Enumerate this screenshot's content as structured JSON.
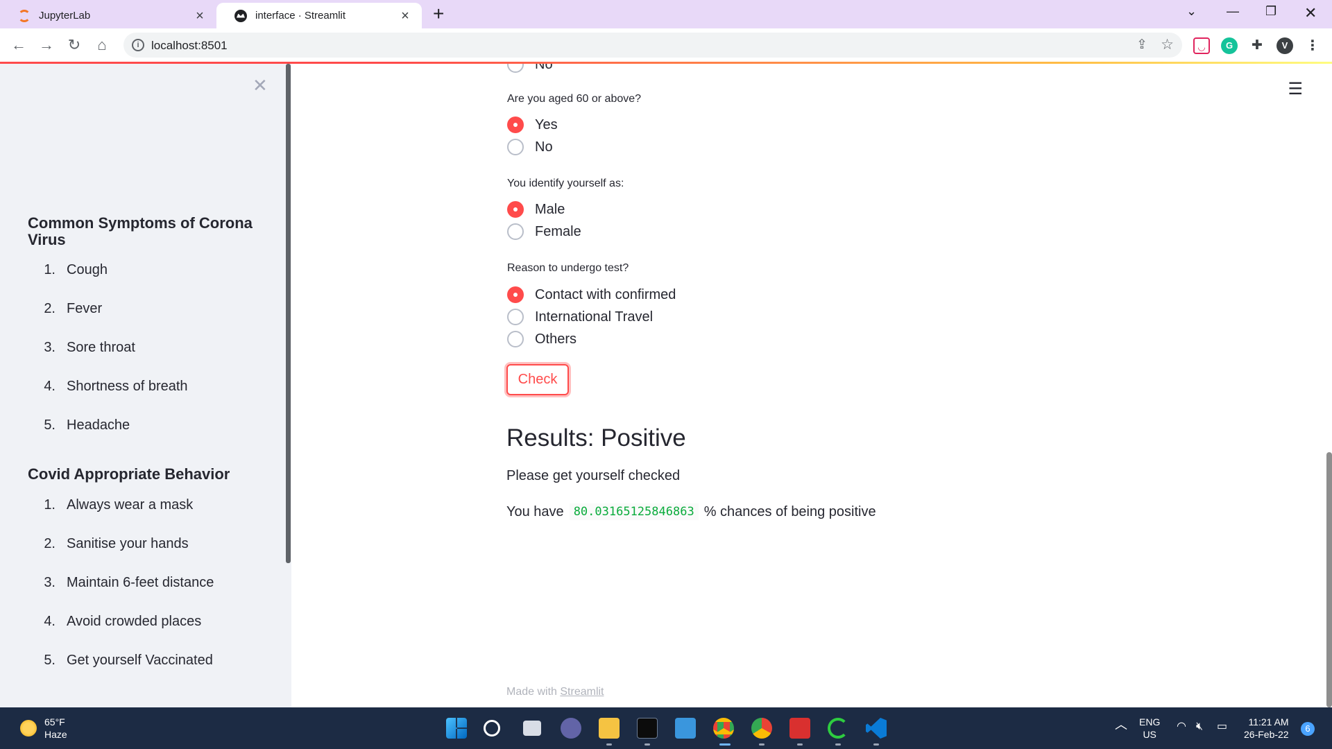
{
  "browser": {
    "tabs": [
      {
        "title": "JupyterLab"
      },
      {
        "title": "interface · Streamlit"
      }
    ],
    "url": "localhost:8501",
    "profile_initial": "V"
  },
  "sidebar": {
    "symptoms_heading": "Common Symptoms of Corona Virus",
    "symptoms": [
      {
        "num": "1.",
        "text": "Cough"
      },
      {
        "num": "2.",
        "text": "Fever"
      },
      {
        "num": "3.",
        "text": "Sore throat"
      },
      {
        "num": "4.",
        "text": "Shortness of breath"
      },
      {
        "num": "5.",
        "text": "Headache"
      }
    ],
    "behavior_heading": "Covid Appropriate Behavior",
    "behaviors": [
      {
        "num": "1.",
        "text": "Always wear a mask"
      },
      {
        "num": "2.",
        "text": "Sanitise your hands"
      },
      {
        "num": "3.",
        "text": "Maintain 6-feet distance"
      },
      {
        "num": "4.",
        "text": "Avoid crowded places"
      },
      {
        "num": "5.",
        "text": "Get yourself Vaccinated"
      }
    ]
  },
  "form": {
    "partial_option": "No",
    "age_question": "Are you aged 60 or above?",
    "age_options": [
      "Yes",
      "No"
    ],
    "age_selected": "Yes",
    "gender_question": "You identify yourself as:",
    "gender_options": [
      "Male",
      "Female"
    ],
    "gender_selected": "Male",
    "reason_question": "Reason to undergo test?",
    "reason_options": [
      "Contact with confirmed",
      "International Travel",
      "Others"
    ],
    "reason_selected": "Contact with confirmed",
    "check_label": "Check"
  },
  "result": {
    "title": "Results: Positive",
    "message": "Please get yourself checked",
    "chance_prefix": "You have",
    "chance_value": "80.03165125846863",
    "chance_suffix": "% chances of being positive"
  },
  "footer": {
    "made_with": "Made with",
    "link": "Streamlit"
  },
  "taskbar": {
    "temperature": "65°F",
    "weather": "Haze",
    "lang_top": "ENG",
    "lang_bottom": "US",
    "time": "11:21 AM",
    "date": "26-Feb-22",
    "notifications": "6"
  },
  "colors": {
    "accent": "#ff4b4b",
    "code_green": "#09ab3b",
    "sidebar_bg": "#f0f2f6",
    "taskbar_bg": "#1c2b44",
    "tabbar_bg": "#e8d9f8"
  }
}
